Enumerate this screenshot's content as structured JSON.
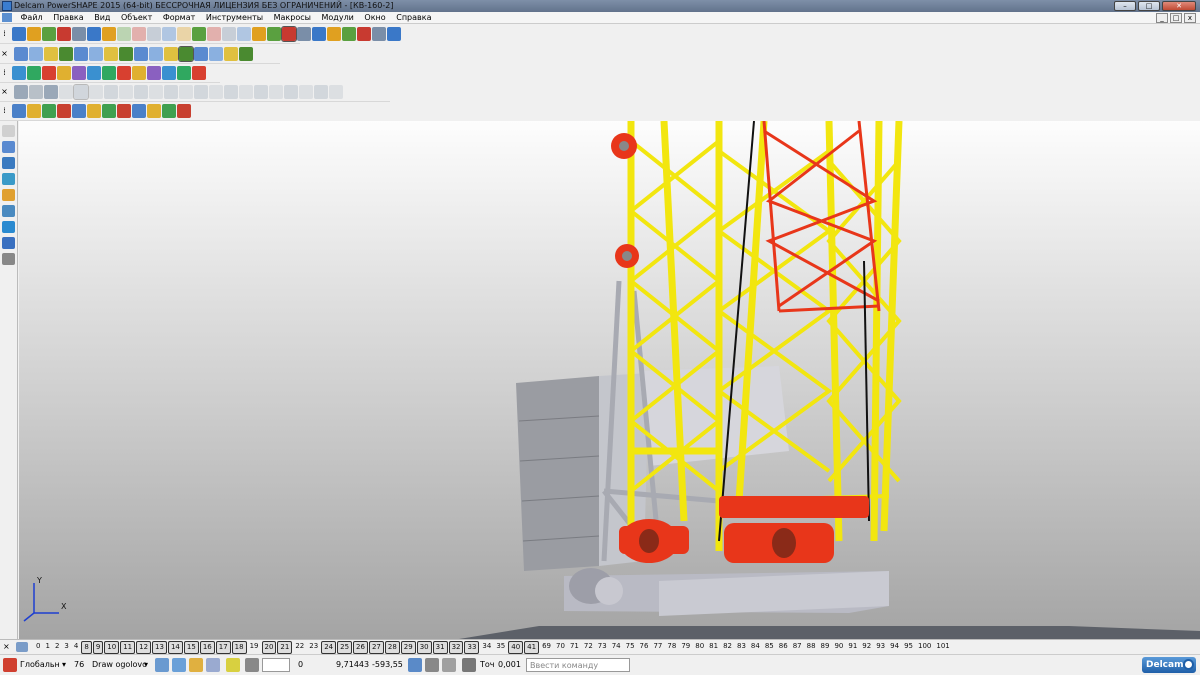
{
  "window": {
    "title": "Delcam PowerSHAPE 2015 (64-bit) БЕССРОЧНАЯ ЛИЦЕНЗИЯ БЕЗ ОГРАНИЧЕНИЙ - [КВ-160-2]",
    "min": "–",
    "max": "□",
    "close": "✕"
  },
  "menu": {
    "items": [
      "Файл",
      "Правка",
      "Вид",
      "Объект",
      "Формат",
      "Инструменты",
      "Макросы",
      "Модули",
      "Окно",
      "Справка"
    ],
    "mdi_min": "_",
    "mdi_max": "□",
    "mdi_close": "x"
  },
  "toolbars": {
    "grip": "×"
  },
  "axes": {
    "x": "X",
    "y": "Y"
  },
  "layers": {
    "close": "×",
    "numbers": [
      "0",
      "1",
      "2",
      "3",
      "4",
      "8",
      "9",
      "10",
      "11",
      "12",
      "13",
      "14",
      "15",
      "16",
      "17",
      "18",
      "19",
      "20",
      "21",
      "22",
      "23",
      "24",
      "25",
      "26",
      "27",
      "28",
      "29",
      "30",
      "31",
      "32",
      "33",
      "34",
      "35",
      "40",
      "41",
      "69",
      "70",
      "71",
      "72",
      "73",
      "74",
      "75",
      "76",
      "77",
      "78",
      "79",
      "80",
      "81",
      "82",
      "83",
      "84",
      "85",
      "86",
      "87",
      "88",
      "89",
      "90",
      "91",
      "92",
      "93",
      "94",
      "95",
      "100",
      "101"
    ],
    "used": [
      "8",
      "9",
      "10",
      "11",
      "12",
      "13",
      "14",
      "15",
      "16",
      "17",
      "18",
      "20",
      "21",
      "24",
      "25",
      "26",
      "27",
      "28",
      "29",
      "30",
      "31",
      "32",
      "33",
      "40",
      "41"
    ]
  },
  "status": {
    "workplane": "Глобальн",
    "level_number": "76",
    "level_name": "Draw ogolovc",
    "selected_count": "0",
    "coord_x": "9,71443",
    "coord_y": "-593,55",
    "tolerance_label": "Точ",
    "tolerance": "0,001",
    "command_placeholder": "Ввести команду",
    "brand": "Delcam"
  },
  "colors": {
    "mast_yellow": "#f2e60f",
    "mast_red": "#e8361a",
    "machine_gray": "#bdbdc6"
  }
}
